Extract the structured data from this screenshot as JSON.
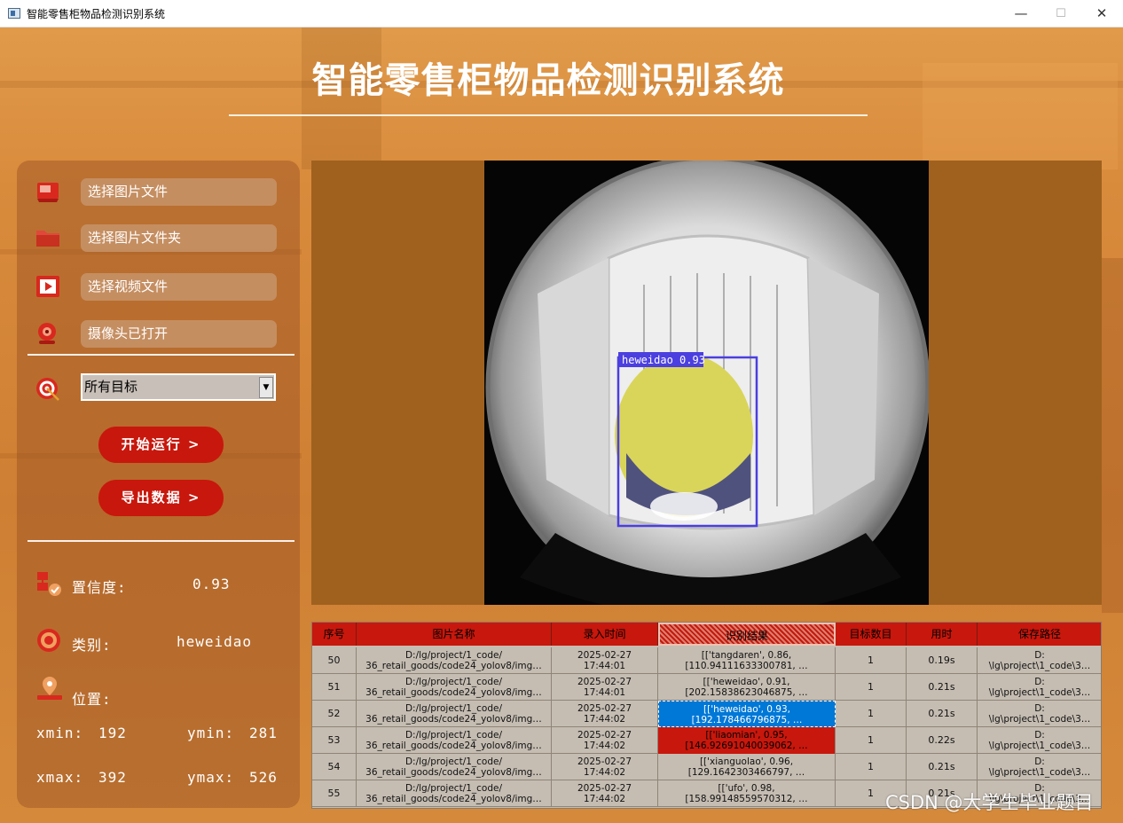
{
  "window": {
    "title": "智能零售柜物品检测识别系统",
    "min_glyph": "—",
    "max_glyph": "☐",
    "close_glyph": "✕"
  },
  "header": {
    "title": "智能零售柜物品检测识别系统"
  },
  "sidebar": {
    "items": [
      {
        "label": "选择图片文件",
        "icon": "image-file-icon"
      },
      {
        "label": "选择图片文件夹",
        "icon": "folder-icon"
      },
      {
        "label": "选择视频文件",
        "icon": "video-file-icon"
      },
      {
        "label": "摄像头已打开",
        "icon": "camera-icon"
      }
    ],
    "target_select": {
      "value": "所有目标",
      "arrow": "▼"
    },
    "start_button": "开始运行 >",
    "export_button": "导出数据 >"
  },
  "info": {
    "confidence_label": "置信度:",
    "confidence_value": "0.93",
    "class_label": "类别:",
    "class_value": "heweidao",
    "position_label": "位置:",
    "xmin_label": "xmin:",
    "xmin_value": "192",
    "ymin_label": "ymin:",
    "ymin_value": "281",
    "xmax_label": "xmax:",
    "xmax_value": "392",
    "ymax_label": "ymax:",
    "ymax_value": "526"
  },
  "detection": {
    "label": "heweidao 0.93",
    "box_color": "#4b3fe0"
  },
  "table": {
    "headers": [
      "序号",
      "图片名称",
      "录入时间",
      "识别结果",
      "目标数目",
      "用时",
      "保存路径"
    ],
    "rows": [
      {
        "id": "50",
        "name": "D:/lg/project/1_code/\n36_retail_goods/code24_yolov8/img…",
        "time": "2025-02-27\n17:44:01",
        "result": "[['tangdaren', 0.86,\n[110.94111633300781, …",
        "count": "1",
        "cost": "0.19s",
        "path": "D:\n\\lg\\project\\1_code\\3…"
      },
      {
        "id": "51",
        "name": "D:/lg/project/1_code/\n36_retail_goods/code24_yolov8/img…",
        "time": "2025-02-27\n17:44:01",
        "result": "[['heweidao', 0.91,\n[202.15838623046875, …",
        "count": "1",
        "cost": "0.21s",
        "path": "D:\n\\lg\\project\\1_code\\3…"
      },
      {
        "id": "52",
        "name": "D:/lg/project/1_code/\n36_retail_goods/code24_yolov8/img…",
        "time": "2025-02-27\n17:44:02",
        "result": "[['heweidao', 0.93,\n[192.178466796875, …",
        "count": "1",
        "cost": "0.21s",
        "path": "D:\n\\lg\\project\\1_code\\3…"
      },
      {
        "id": "53",
        "name": "D:/lg/project/1_code/\n36_retail_goods/code24_yolov8/img…",
        "time": "2025-02-27\n17:44:02",
        "result": "[['liaomian', 0.95,\n[146.92691040039062, …",
        "count": "1",
        "cost": "0.22s",
        "path": "D:\n\\lg\\project\\1_code\\3…"
      },
      {
        "id": "54",
        "name": "D:/lg/project/1_code/\n36_retail_goods/code24_yolov8/img…",
        "time": "2025-02-27\n17:44:02",
        "result": "[['xianguolao', 0.96,\n[129.1642303466797, …",
        "count": "1",
        "cost": "0.21s",
        "path": "D:\n\\lg\\project\\1_code\\3…"
      },
      {
        "id": "55",
        "name": "D:/lg/project/1_code/\n36_retail_goods/code24_yolov8/img…",
        "time": "2025-02-27\n17:44:02",
        "result": "[['ufo', 0.98,\n[158.99148559570312, …",
        "count": "1",
        "cost": "0.21s",
        "path": "D:\n\\lg\\project\\1_code\\3…"
      }
    ]
  },
  "watermark": "CSDN @大学生毕业题目"
}
